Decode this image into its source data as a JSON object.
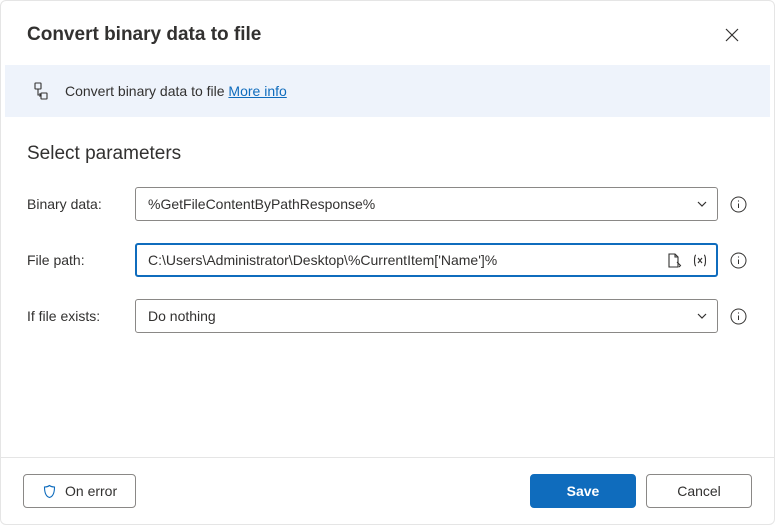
{
  "header": {
    "title": "Convert binary data to file"
  },
  "info_bar": {
    "text": "Convert binary data to file ",
    "link": "More info"
  },
  "section": {
    "title": "Select parameters"
  },
  "fields": {
    "binary_data": {
      "label": "Binary data:",
      "value": "%GetFileContentByPathResponse%"
    },
    "file_path": {
      "label": "File path:",
      "value": "C:\\Users\\Administrator\\Desktop\\%CurrentItem['Name']%"
    },
    "if_file_exists": {
      "label": "If file exists:",
      "value": "Do nothing"
    }
  },
  "footer": {
    "on_error": "On error",
    "save": "Save",
    "cancel": "Cancel"
  }
}
